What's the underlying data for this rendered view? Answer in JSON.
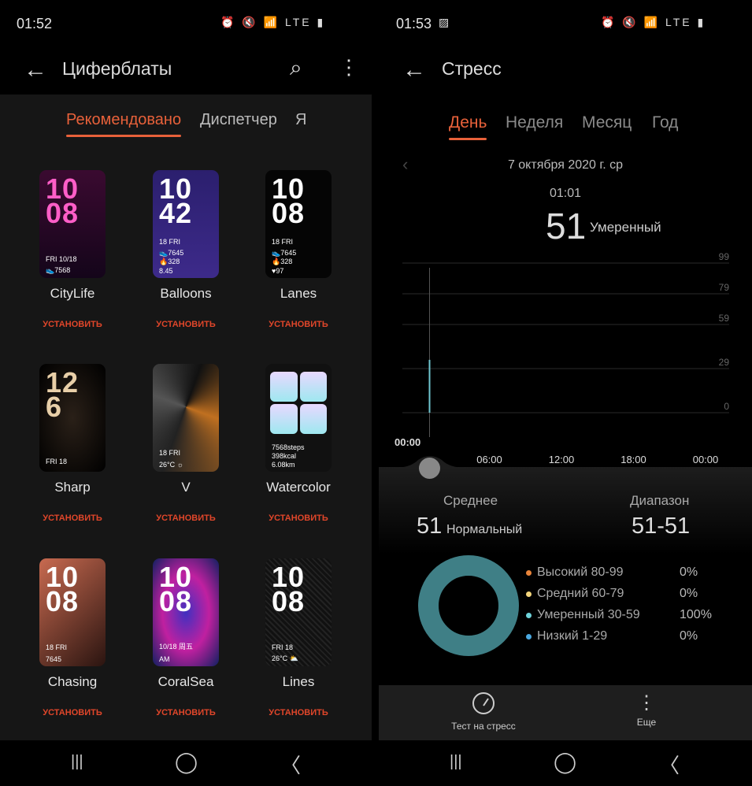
{
  "left": {
    "status": {
      "time": "01:52",
      "icons": "⏰ 🔇 📶 LTE ▮"
    },
    "appbar": {
      "title": "Циферблаты"
    },
    "tabs": [
      "Рекомендовано",
      "Диспетчер",
      "Я"
    ],
    "install_label": "УСТАНОВИТЬ",
    "faces": [
      {
        "name": "CityLife",
        "time": [
          "10",
          "08"
        ],
        "date": "FRI 10/18",
        "info": [
          "👟7568"
        ]
      },
      {
        "name": "Balloons",
        "time": [
          "10",
          "42"
        ],
        "date": "18 FRI",
        "info": [
          "👟7645",
          "🔥328",
          "8.45"
        ]
      },
      {
        "name": "Lanes",
        "time": [
          "10",
          "08"
        ],
        "date": "18 FRI",
        "info": [
          "👟7645",
          "🔥328",
          "♥97"
        ]
      },
      {
        "name": "Sharp",
        "time": [
          "12",
          "6"
        ],
        "date": "FRI 18",
        "info": []
      },
      {
        "name": "V",
        "time": [
          "",
          ""
        ],
        "date": "18 FRI",
        "info": [
          "26°C ☼"
        ]
      },
      {
        "name": "Watercolor",
        "time": [
          "",
          ""
        ],
        "date": "",
        "info": [
          "7568steps",
          "398kcal",
          "6.08km"
        ]
      },
      {
        "name": "Chasing",
        "time": [
          "10",
          "08"
        ],
        "date": "18  FRI",
        "info": [
          "7645"
        ]
      },
      {
        "name": "CoralSea",
        "time": [
          "10",
          "08"
        ],
        "date": "10/18 周五",
        "info": [
          "AM"
        ]
      },
      {
        "name": "Lines",
        "time": [
          "10",
          "08"
        ],
        "date": "FRI 18",
        "info": [
          "26°C ⛅"
        ]
      }
    ]
  },
  "right": {
    "status": {
      "time": "01:53",
      "icons": "⏰ 🔇 📶 LTE ▮"
    },
    "appbar": {
      "title": "Стресс"
    },
    "tabs": [
      "День",
      "Неделя",
      "Месяц",
      "Год"
    ],
    "date": "7 октября 2020 г. ср",
    "selected": {
      "time": "01:01",
      "value": "51",
      "level": "Умеренный"
    },
    "chart_data": {
      "type": "bar",
      "x_ticks": [
        "00:00",
        "06:00",
        "12:00",
        "18:00",
        "00:00"
      ],
      "y_ticks": [
        99,
        79,
        59,
        29,
        0
      ],
      "points": [
        {
          "x": "01:01",
          "y": 51
        }
      ],
      "bar_color": "#6fc6d0"
    },
    "summary": {
      "avg_label": "Среднее",
      "avg_value": "51",
      "avg_level": "Нормальный",
      "range_label": "Диапазон",
      "range_value": "51-51"
    },
    "legend": [
      {
        "label": "Высокий 80-99",
        "pct": "0%",
        "color": "#e8843a"
      },
      {
        "label": "Средний 60-79",
        "pct": "0%",
        "color": "#f3d57c"
      },
      {
        "label": "Умеренный 30-59",
        "pct": "100%",
        "color": "#6fd3da"
      },
      {
        "label": "Низкий 1-29",
        "pct": "0%",
        "color": "#4aa8e0"
      }
    ],
    "donut_color": "#3f7f86",
    "bottom": {
      "test": "Тест на стресс",
      "more": "Еще"
    }
  },
  "nav": {
    "recents": "|||",
    "home": "◯",
    "back": "〈"
  }
}
